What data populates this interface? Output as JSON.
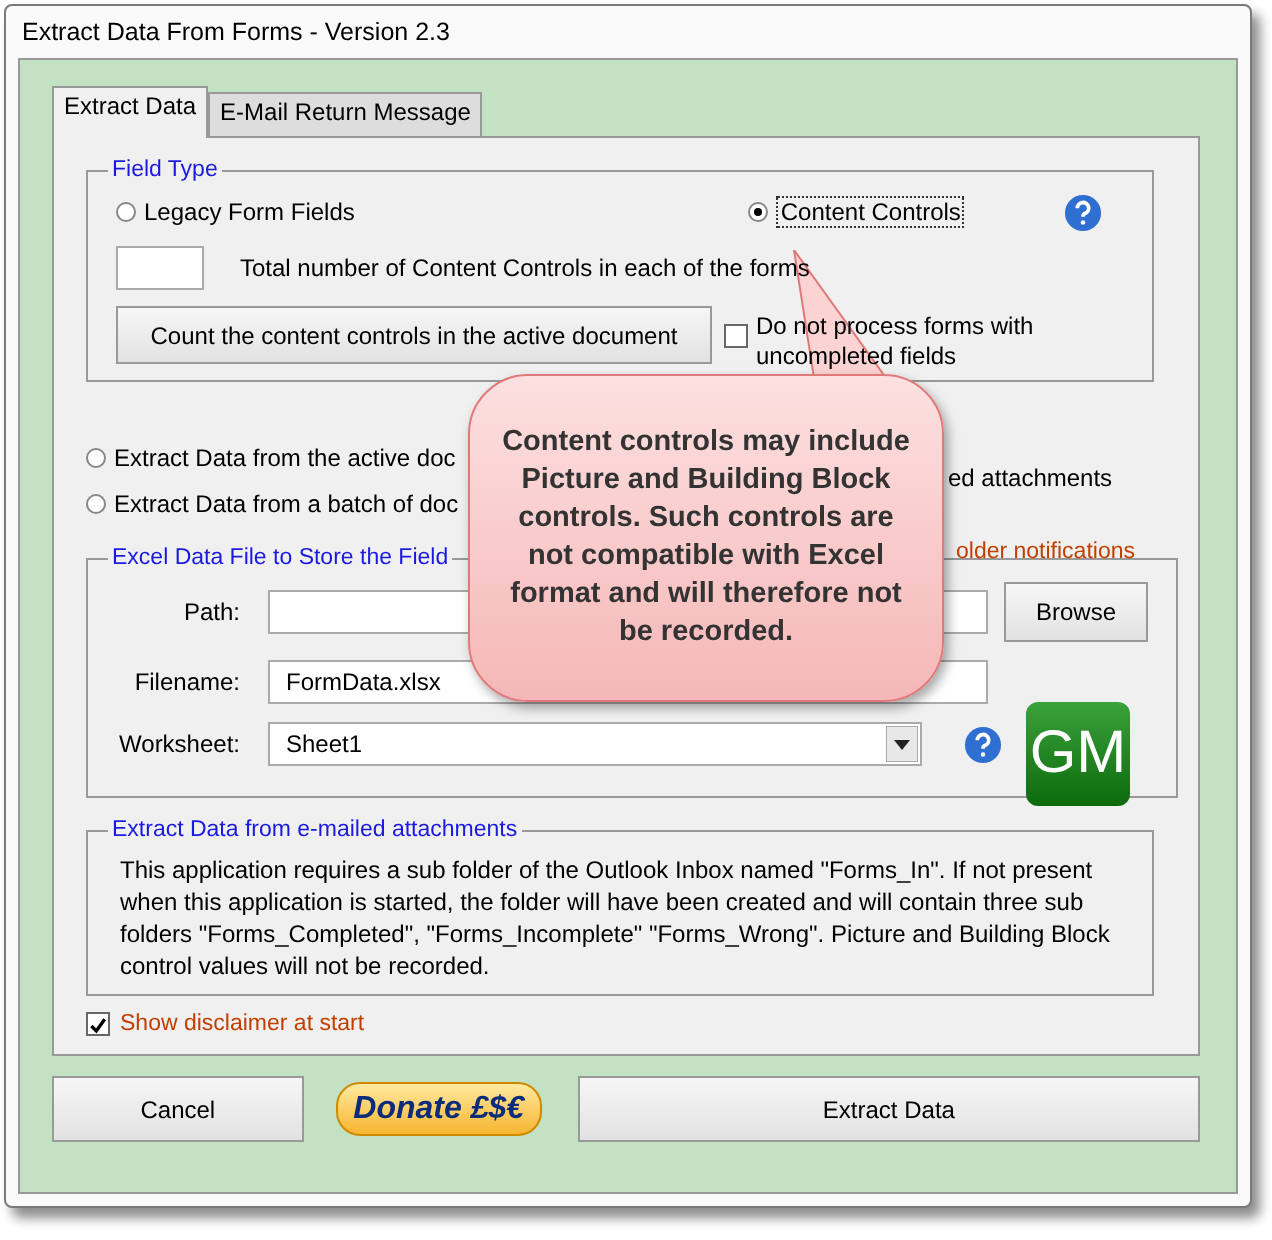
{
  "window": {
    "title": "Extract Data From Forms - Version 2.3"
  },
  "tabs": [
    {
      "label": "Extract Data",
      "selected": true
    },
    {
      "label": "E-Mail Return Message",
      "selected": false
    }
  ],
  "field_type": {
    "legend": "Field Type",
    "options": [
      {
        "label": "Legacy Form Fields",
        "selected": false
      },
      {
        "label": "Content Controls",
        "selected": true
      }
    ],
    "count_label": "Total number of Content Controls in each of the forms",
    "count_button": "Count the content controls in the active document",
    "skip_incomplete": {
      "label": "Do not process forms with uncompleted fields",
      "checked": false
    }
  },
  "source_options": [
    {
      "label": "Extract Data from the active doc",
      "selected": false
    },
    {
      "label": "Extract Data from a batch of doc",
      "selected": false
    }
  ],
  "covered_texts": [
    {
      "text": "ed attachments",
      "kind": "option"
    },
    {
      "text": "older notifications",
      "kind": "note"
    }
  ],
  "excel": {
    "legend": "Excel Data File to Store the Field",
    "fields": [
      {
        "label": "Path:",
        "kind": "text"
      },
      {
        "label": "Filename:",
        "value": "FormData.xlsx",
        "kind": "text"
      },
      {
        "label": "Worksheet:",
        "value": "Sheet1",
        "kind": "dropdown"
      }
    ],
    "browse": "Browse",
    "logo": "GM"
  },
  "email": {
    "legend": "Extract Data from e-mailed attachments",
    "text": "This application requires a sub folder of the Outlook Inbox named \"Forms_In\". If not present when this application is started, the folder will have been created and will contain three sub folders \"Forms_Completed\", \"Forms_Incomplete\" \"Forms_Wrong\". Picture and Building Block control values will not be recorded."
  },
  "disclaimer": {
    "label": "Show disclaimer at start",
    "checked": true
  },
  "buttons": {
    "cancel": "Cancel",
    "donate": "Donate £$€",
    "extract": "Extract Data"
  },
  "callout": {
    "text": "Content controls may include Picture and Building Block controls. Such controls are not compatible with Excel format and will therefore not be recorded."
  }
}
